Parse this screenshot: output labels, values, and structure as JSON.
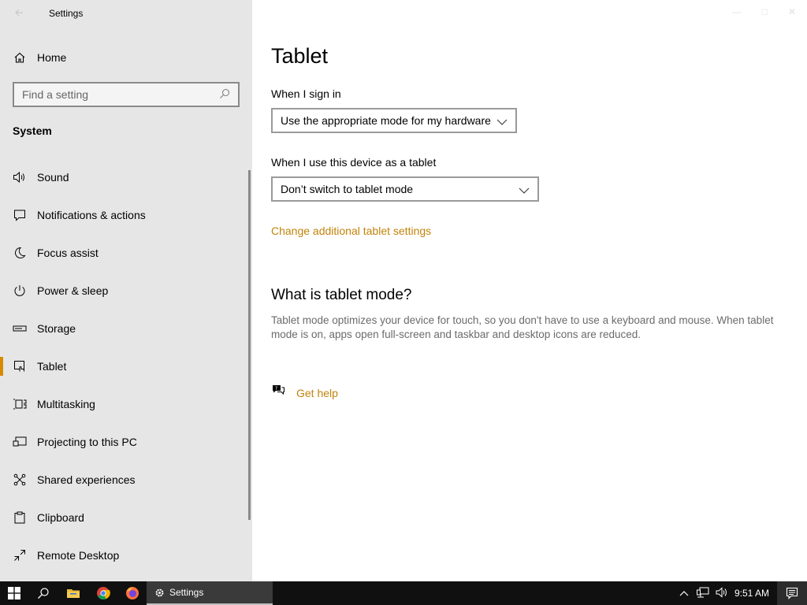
{
  "window": {
    "title": "Settings"
  },
  "sidebar": {
    "home_label": "Home",
    "search_placeholder": "Find a setting",
    "section_title": "System",
    "items": [
      {
        "label": "Sound",
        "icon": "speaker-icon"
      },
      {
        "label": "Notifications & actions",
        "icon": "notification-icon"
      },
      {
        "label": "Focus assist",
        "icon": "moon-icon"
      },
      {
        "label": "Power & sleep",
        "icon": "power-icon"
      },
      {
        "label": "Storage",
        "icon": "storage-icon"
      },
      {
        "label": "Tablet",
        "icon": "tablet-icon",
        "selected": true
      },
      {
        "label": "Multitasking",
        "icon": "multitasking-icon"
      },
      {
        "label": "Projecting to this PC",
        "icon": "projecting-icon"
      },
      {
        "label": "Shared experiences",
        "icon": "shared-experiences-icon"
      },
      {
        "label": "Clipboard",
        "icon": "clipboard-icon"
      },
      {
        "label": "Remote Desktop",
        "icon": "remote-desktop-icon"
      }
    ]
  },
  "main": {
    "title": "Tablet",
    "sign_in_label": "When I sign in",
    "sign_in_value": "Use the appropriate mode for my hardware",
    "tablet_label": "When I use this device as a tablet",
    "tablet_value": "Don’t switch to tablet mode",
    "additional_link": "Change additional tablet settings",
    "what_is_heading": "What is tablet mode?",
    "what_is_text": "Tablet mode optimizes your device for touch, so you don't have to use a keyboard and mouse. When tablet mode is on, apps open full-screen and taskbar and desktop icons are reduced.",
    "get_help": "Get help"
  },
  "taskbar": {
    "active_app": "Settings",
    "clock": "9:51 AM"
  },
  "colors": {
    "accent": "#d68a00",
    "link": "#c2830a",
    "sidebar_bg": "#e6e6e6",
    "taskbar_bg": "#101010"
  }
}
